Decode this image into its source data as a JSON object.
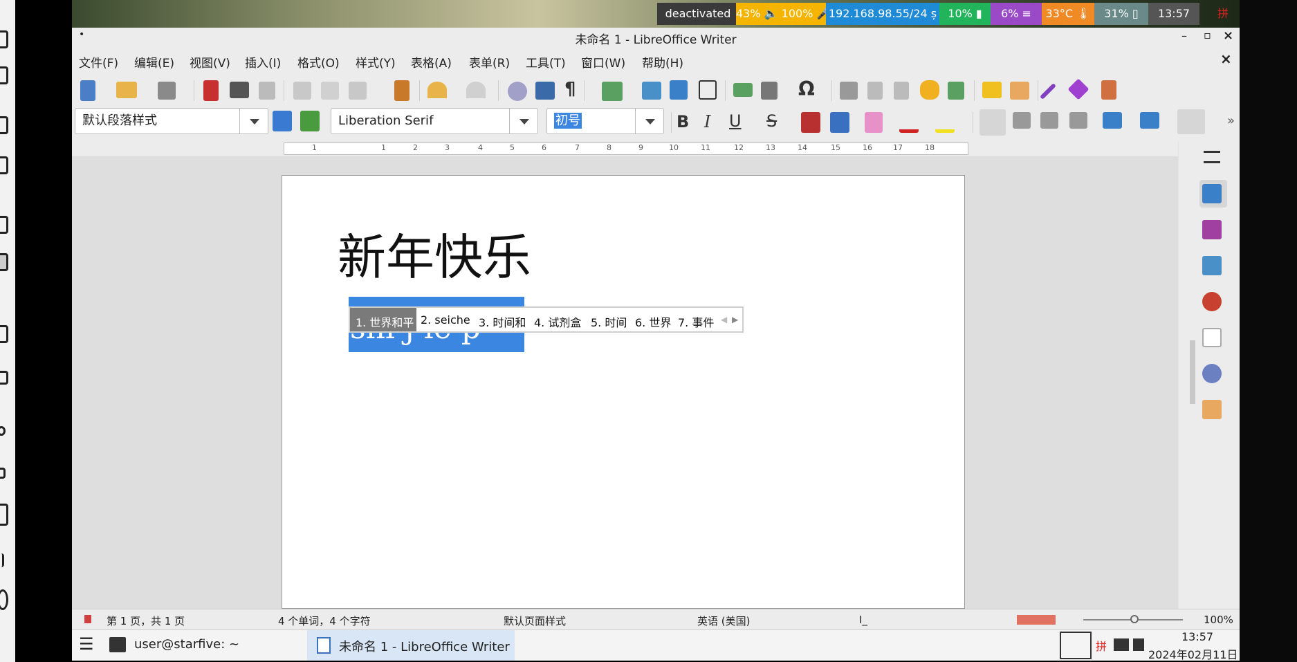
{
  "topbar": {
    "segments": [
      {
        "text": "deactivated",
        "color": "#3a3a3a"
      },
      {
        "text": "43% 🔈 100% 🎤",
        "color": "#f5b400"
      },
      {
        "text": "192.168.98.55/24 ș",
        "color": "#1f8ad6"
      },
      {
        "text": "10% ▮",
        "color": "#22b45a"
      },
      {
        "text": "6% ≡",
        "color": "#9a49c7"
      },
      {
        "text": "33°C 🌡",
        "color": "#f08a24"
      },
      {
        "text": "31% ▯",
        "color": "#6a8a8a"
      },
      {
        "text": "13:57",
        "color": "#555555"
      },
      {
        "text": "拼",
        "color": "#2a6fdb"
      }
    ]
  },
  "window": {
    "title": "未命名 1 - LibreOffice Writer",
    "pin_glyph": "•",
    "minimize": "–",
    "restore": "▫",
    "close": "×"
  },
  "menu": {
    "items": [
      "文件(F)",
      "编辑(E)",
      "视图(V)",
      "插入(I)",
      "格式(O)",
      "样式(Y)",
      "表格(A)",
      "表单(R)",
      "工具(T)",
      "窗口(W)",
      "帮助(H)"
    ],
    "close": "×"
  },
  "format": {
    "paragraph_style": "默认段落样式",
    "font_name": "Liberation Serif",
    "font_size": "初号",
    "bold": "B",
    "italic": "I",
    "underline": "U",
    "strike": "S",
    "more": "»"
  },
  "document": {
    "heading": "新年快乐",
    "preedit": "shi j ie p"
  },
  "ime": {
    "candidates": [
      "1. 世界和平",
      "2. seiche",
      "3. 时间和",
      "4. 试剂盒",
      "5. 时间",
      "6. 世界",
      "7. 事件"
    ],
    "prev": "◀",
    "next": "▶"
  },
  "ruler": {
    "ticks": [
      "1",
      "1",
      "2",
      "3",
      "4",
      "5",
      "6",
      "7",
      "8",
      "9",
      "10",
      "11",
      "12",
      "13",
      "14",
      "15",
      "16",
      "17",
      "18"
    ]
  },
  "status": {
    "page": "第 1 页，共 1 页",
    "words": "4 个单词，4 个字符",
    "page_style": "默认页面样式",
    "language": "英语 (美国)",
    "cursor": "I_",
    "zoom": "100%"
  },
  "taskbar": {
    "menu_glyph": "☰",
    "terminal": "user@starfive: ~",
    "writer": "未命名 1 - LibreOffice Writer",
    "ime_glyph": "拼",
    "time": "13:57",
    "date": "2024年02月11日"
  }
}
